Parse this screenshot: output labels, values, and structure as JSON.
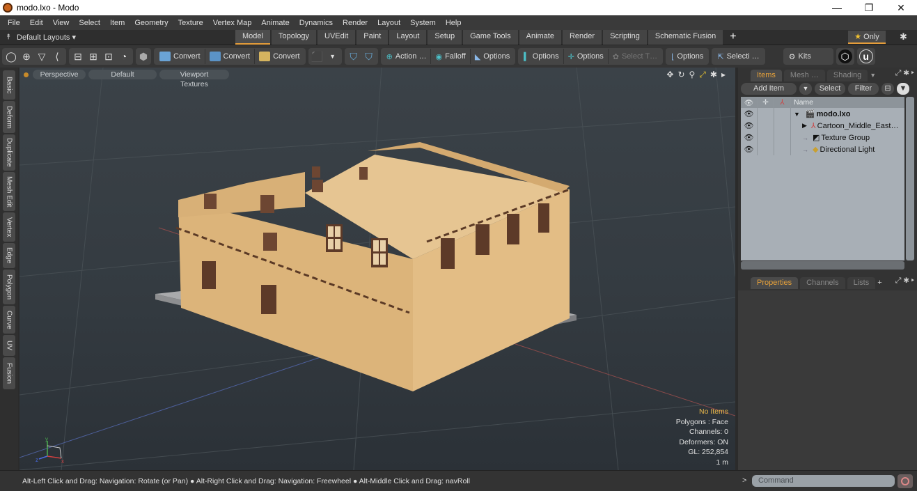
{
  "window": {
    "title": "modo.lxo - Modo",
    "minimize": "—",
    "restore": "❐",
    "close": "✕"
  },
  "menu": [
    "File",
    "Edit",
    "View",
    "Select",
    "Item",
    "Geometry",
    "Texture",
    "Vertex Map",
    "Animate",
    "Dynamics",
    "Render",
    "Layout",
    "System",
    "Help"
  ],
  "layoutbar": {
    "default_layouts": "Default Layouts ▾",
    "tabs": [
      "Model",
      "Topology",
      "UVEdit",
      "Paint",
      "Layout",
      "Setup",
      "Game Tools",
      "Animate",
      "Render",
      "Scripting",
      "Schematic Fusion"
    ],
    "active_tab": "Model",
    "add_tab": "+",
    "only_label": "Only",
    "star": "★",
    "gear": "✱"
  },
  "toolbar": {
    "convert1": "Convert",
    "convert2": "Convert",
    "convert3": "Convert",
    "action": "Action …",
    "falloff": "Falloff",
    "options1": "Options",
    "options2": "Options",
    "options3": "Options",
    "select_t": "Select T…",
    "options4": "Options",
    "selecti": "Selecti …",
    "kits": "Kits"
  },
  "left_tabs": [
    "Basic",
    "Deform",
    "Duplicate",
    "Mesh Edit",
    "Vertex",
    "Edge",
    "Polygon",
    "Curve",
    "UV",
    "Fusion"
  ],
  "viewport": {
    "view": "Perspective",
    "shading": "Default",
    "textures": "Viewport Textures",
    "stats": {
      "items": "No Items",
      "polygons": "Polygons : Face",
      "channels": "Channels: 0",
      "deformers": "Deformers: ON",
      "gl": "GL: 252,854",
      "scale": "1 m"
    }
  },
  "status": "Alt-Left Click and Drag: Navigation: Rotate (or Pan) ● Alt-Right Click and Drag: Navigation: Freewheel ● Alt-Middle Click and Drag: navRoll",
  "items_panel": {
    "tabs": [
      "Items",
      "Mesh …",
      "Shading"
    ],
    "add_item": "Add Item",
    "select": "Select",
    "filter": "Filter",
    "name_col": "Name",
    "rows": [
      {
        "name": "modo.lxo",
        "expander": "▼"
      },
      {
        "name": "Cartoon_Middle_East…",
        "expander": "▶"
      },
      {
        "name": "Texture Group",
        "expander": "→"
      },
      {
        "name": "Directional Light",
        "expander": "→"
      }
    ]
  },
  "props_panel": {
    "tabs": [
      "Properties",
      "Channels",
      "Lists"
    ],
    "add": "+"
  },
  "command": {
    "prompt": ">",
    "placeholder": "Command"
  }
}
